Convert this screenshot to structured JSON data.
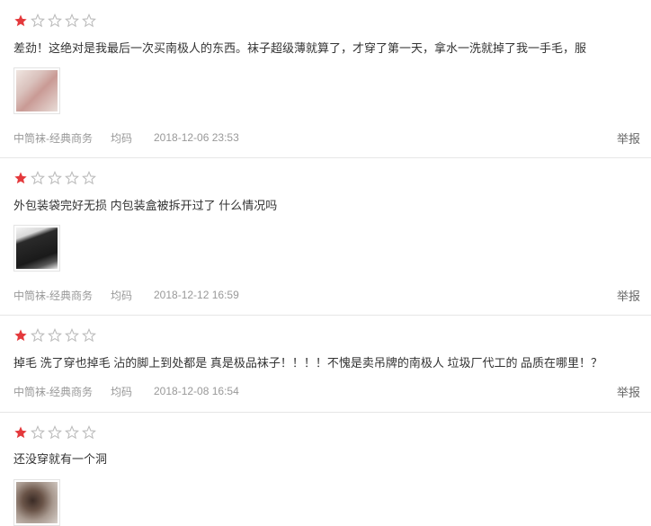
{
  "colors": {
    "star_filled": "#e4393c",
    "star_empty": "#bbbbbb"
  },
  "reviews": [
    {
      "rating": 1,
      "text": "差劲！这绝对是我最后一次买南极人的东西。袜子超级薄就算了，才穿了第一天，拿水一洗就掉了我一手毛，服",
      "has_image": true,
      "variant": "中筒袜-经典商务",
      "size": "均码",
      "date": "2018-12-06 23:53",
      "report": "举报"
    },
    {
      "rating": 1,
      "text": "外包装袋完好无损 内包装盒被拆开过了 什么情况吗",
      "has_image": true,
      "variant": "中筒袜-经典商务",
      "size": "均码",
      "date": "2018-12-12 16:59",
      "report": "举报"
    },
    {
      "rating": 1,
      "text": "掉毛 洗了穿也掉毛 沾的脚上到处都是 真是极品袜子！！！！不愧是卖吊牌的南极人 垃圾厂代工的 品质在哪里！？",
      "has_image": false,
      "variant": "中筒袜-经典商务",
      "size": "均码",
      "date": "2018-12-08 16:54",
      "report": "举报"
    },
    {
      "rating": 1,
      "text": "还没穿就有一个洞",
      "has_image": true
    }
  ]
}
